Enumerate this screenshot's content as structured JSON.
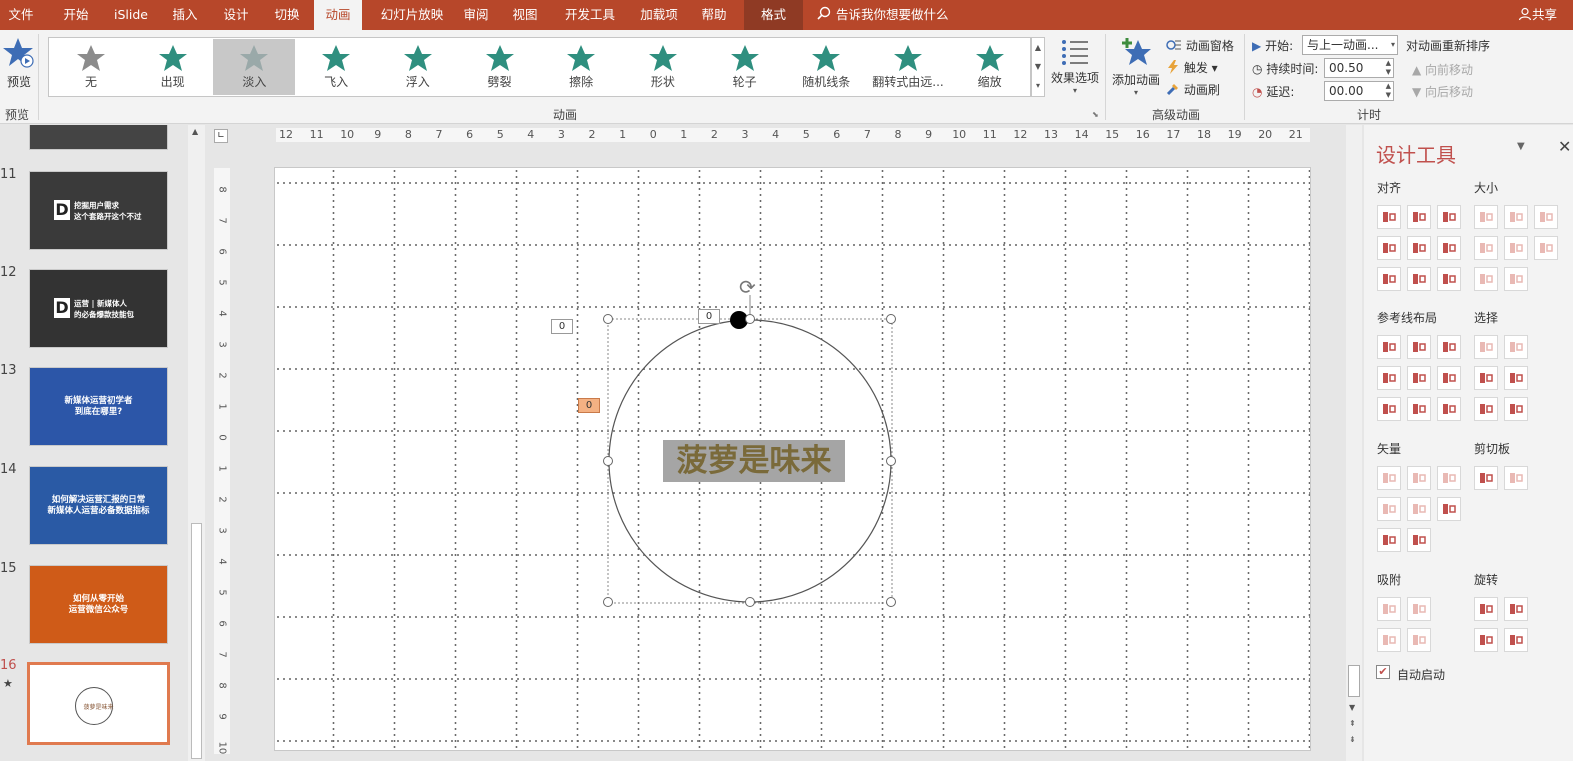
{
  "tabs": [
    "文件",
    "开始",
    "iSlide",
    "插入",
    "设计",
    "切换",
    "动画",
    "幻灯片放映",
    "审阅",
    "视图",
    "开发工具",
    "加载项",
    "帮助",
    "格式"
  ],
  "search": "告诉我你想要做什么",
  "share": "共享",
  "ribbon": {
    "preview": "预览",
    "preview_group": "预览",
    "gallery": [
      "无",
      "出现",
      "淡入",
      "飞入",
      "浮入",
      "劈裂",
      "擦除",
      "形状",
      "轮子",
      "随机线条",
      "翻转式由远...",
      "缩放"
    ],
    "effect_options": "效果选项",
    "anim_group": "动画",
    "add_anim": "添加动画",
    "anim_pane": "动画窗格",
    "trigger": "触发",
    "anim_brush": "动画刷",
    "adv_group": "高级动画",
    "start_label": "开始:",
    "start_value": "与上一动画...",
    "duration_label": "持续时间:",
    "duration_value": "00.50",
    "delay_label": "延迟:",
    "delay_value": "00.00",
    "timing_group": "计时",
    "reorder_title": "对动画重新排序",
    "move_earlier": "向前移动",
    "move_later": "向后移动"
  },
  "slides": [
    {
      "num": "11",
      "text": "挖掘用户需求\n这个套路开这个不过",
      "color": "#3a3a3a"
    },
    {
      "num": "12",
      "text": "运营 | 新媒体人\n的必备爆款技能包",
      "color": "#333333"
    },
    {
      "num": "13",
      "text": "新媒体运营初学者\n到底在哪里?",
      "color": "#2c56a8"
    },
    {
      "num": "14",
      "text": "如何解决运营汇报的日常\n新媒体人运营必备数据指标",
      "color": "#2a5aa5"
    },
    {
      "num": "15",
      "text": "如何从零开始\n运营微信公众号",
      "color": "#cf5b18"
    },
    {
      "num": "16",
      "text": "菠萝是味来",
      "color": "#ffffff"
    }
  ],
  "slide_star": "★",
  "hruler": [
    "12",
    "11",
    "10",
    "9",
    "8",
    "7",
    "6",
    "5",
    "4",
    "3",
    "2",
    "1",
    "0",
    "1",
    "2",
    "3",
    "4",
    "5",
    "6",
    "7",
    "8",
    "9",
    "10",
    "11",
    "12",
    "13",
    "14",
    "15",
    "16",
    "17",
    "18",
    "19",
    "20",
    "21"
  ],
  "vruler": [
    "8",
    "7",
    "6",
    "5",
    "4",
    "3",
    "2",
    "1",
    "0",
    "1",
    "2",
    "3",
    "4",
    "5",
    "6",
    "7",
    "8",
    "9",
    "10"
  ],
  "canvas": {
    "text": "菠萝是味来",
    "tag_a": "0",
    "tag_b": "0",
    "tag_c": "0"
  },
  "panel": {
    "title": "设计工具",
    "align": "对齐",
    "size": "大小",
    "guides": "参考线布局",
    "select": "选择",
    "vector": "矢量",
    "clipboard": "剪切板",
    "snap": "吸附",
    "rotate": "旋转",
    "auto_start": "自动启动"
  },
  "colors": {
    "accent": "#b7472a",
    "panel_title": "#c0504d",
    "icon": "#c0504d"
  }
}
